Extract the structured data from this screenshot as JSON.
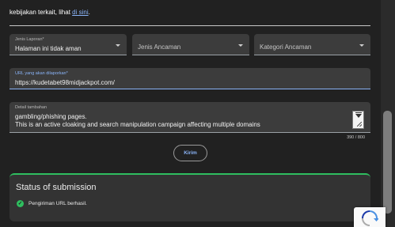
{
  "intro": {
    "text": "kebijakan terkait, lihat ",
    "link": "di sini",
    "suffix": "."
  },
  "form": {
    "report_type": {
      "label": "Jenis Laporan*",
      "value": "Halaman ini tidak aman"
    },
    "threat_type": {
      "placeholder": "Jenis Ancaman"
    },
    "threat_category": {
      "placeholder": "Kategori Ancaman"
    },
    "url": {
      "label": "URL yang akan dilaporkan*",
      "value": "https://kudetabet98midjackpot.com/"
    },
    "details": {
      "label": "Detail tambahan",
      "line1": "gambling/phishing pages.",
      "line2": "This is an active cloaking and search manipulation campaign affecting multiple domains",
      "char_count": "390 / 800"
    },
    "submit_label": "Kirim"
  },
  "status": {
    "title": "Status of submission",
    "message": "Pengiriman URL berhasil.",
    "icon": "check-circle-icon",
    "color": "#2fbe5f"
  },
  "colors": {
    "accent": "#8ab4f8",
    "background": "#212121",
    "field": "#3c3c3c"
  }
}
